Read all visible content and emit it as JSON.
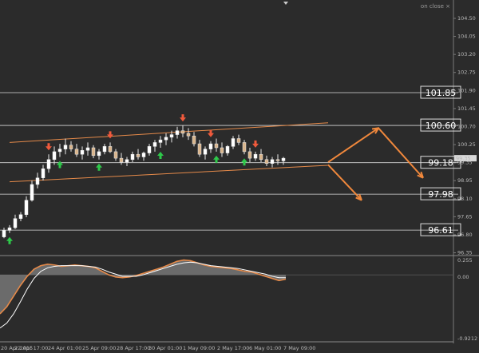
{
  "window": {
    "status_text": "on close ×"
  },
  "chart_data": [
    {
      "type": "candlestick",
      "ylim": [
        95.7,
        105.2
      ],
      "y_ticks": [
        "104.50",
        "104.05",
        "103.20",
        "102.75",
        "101.90",
        "101.45",
        "100.70",
        "100.25",
        "99.35",
        "98.95",
        "98.10",
        "97.65",
        "96.80",
        "96.35"
      ],
      "x_tick_labels": [
        "20 Apr 2015",
        "22 Apr 17:00",
        "24 Apr 01:00",
        "25 Apr 09:00",
        "28 Apr 17:00",
        "30 Apr 01:00",
        "1 May 09:00",
        "2 May 17:00",
        "6 May 01:00",
        "7 May 09:00"
      ],
      "current_price": "99.35",
      "horizontal_levels": [
        {
          "value": 101.85,
          "label": "101.85"
        },
        {
          "value": 100.6,
          "label": "100.60"
        },
        {
          "value": 99.18,
          "label": "99.18"
        },
        {
          "value": 97.98,
          "label": "97.98"
        },
        {
          "value": 96.61,
          "label": "96.61"
        }
      ],
      "channel": {
        "upper": [
          [
            1,
            99.95
          ],
          [
            58,
            100.7
          ]
        ],
        "lower": [
          [
            1,
            98.45
          ],
          [
            58,
            99.08
          ]
        ]
      },
      "forecast_arrows": [
        {
          "points": [
            [
              58,
              99.2
            ],
            [
              67,
              100.5
            ],
            [
              75,
              98.6
            ]
          ]
        },
        {
          "points": [
            [
              58,
              99.1
            ],
            [
              64,
              97.75
            ]
          ]
        }
      ],
      "candles": [
        [
          96.35,
          96.7,
          96.3,
          96.6
        ],
        [
          96.6,
          96.8,
          96.5,
          96.7
        ],
        [
          96.7,
          97.2,
          96.65,
          97.05
        ],
        [
          97.05,
          97.3,
          96.95,
          97.2
        ],
        [
          97.2,
          97.9,
          97.1,
          97.75
        ],
        [
          97.75,
          98.5,
          97.7,
          98.35
        ],
        [
          98.35,
          98.8,
          98.2,
          98.6
        ],
        [
          98.6,
          99.1,
          98.5,
          98.95
        ],
        [
          98.95,
          99.5,
          98.8,
          99.3
        ],
        [
          99.3,
          99.8,
          99.1,
          99.6
        ],
        [
          99.6,
          99.9,
          99.4,
          99.7
        ],
        [
          99.7,
          100.1,
          99.5,
          99.85
        ],
        [
          99.85,
          100.0,
          99.6,
          99.7
        ],
        [
          99.7,
          99.9,
          99.4,
          99.5
        ],
        [
          99.5,
          99.8,
          99.3,
          99.65
        ],
        [
          99.65,
          99.95,
          99.45,
          99.75
        ],
        [
          99.75,
          99.85,
          99.35,
          99.45
        ],
        [
          99.45,
          99.7,
          99.3,
          99.6
        ],
        [
          99.6,
          99.9,
          99.5,
          99.8
        ],
        [
          99.8,
          99.95,
          99.55,
          99.6
        ],
        [
          99.6,
          99.7,
          99.25,
          99.35
        ],
        [
          99.35,
          99.55,
          99.1,
          99.2
        ],
        [
          99.2,
          99.4,
          99.05,
          99.3
        ],
        [
          99.3,
          99.6,
          99.2,
          99.5
        ],
        [
          99.5,
          99.7,
          99.3,
          99.4
        ],
        [
          99.4,
          99.6,
          99.25,
          99.55
        ],
        [
          99.55,
          99.9,
          99.45,
          99.8
        ],
        [
          99.8,
          100.05,
          99.6,
          99.95
        ],
        [
          99.95,
          100.2,
          99.75,
          100.05
        ],
        [
          100.05,
          100.3,
          99.85,
          100.15
        ],
        [
          100.15,
          100.4,
          99.95,
          100.25
        ],
        [
          100.25,
          100.55,
          100.1,
          100.4
        ],
        [
          100.4,
          100.6,
          100.15,
          100.3
        ],
        [
          100.3,
          100.5,
          100.05,
          100.2
        ],
        [
          100.2,
          100.35,
          99.8,
          99.9
        ],
        [
          99.9,
          100.05,
          99.4,
          99.5
        ],
        [
          99.5,
          99.8,
          99.3,
          99.7
        ],
        [
          99.7,
          100.0,
          99.55,
          99.9
        ],
        [
          99.9,
          100.1,
          99.6,
          99.75
        ],
        [
          99.75,
          99.95,
          99.4,
          99.55
        ],
        [
          99.55,
          99.85,
          99.45,
          99.8
        ],
        [
          99.8,
          100.2,
          99.7,
          100.1
        ],
        [
          100.1,
          100.25,
          99.85,
          99.95
        ],
        [
          99.95,
          100.05,
          99.5,
          99.6
        ],
        [
          99.6,
          99.75,
          99.2,
          99.35
        ],
        [
          99.35,
          99.6,
          99.25,
          99.5
        ],
        [
          99.5,
          99.7,
          99.2,
          99.3
        ],
        [
          99.3,
          99.45,
          99.05,
          99.15
        ],
        [
          99.15,
          99.4,
          99.0,
          99.3
        ],
        [
          99.3,
          99.5,
          99.1,
          99.25
        ],
        [
          99.25,
          99.4,
          99.1,
          99.35
        ]
      ],
      "buy_signals": [
        1,
        10,
        17,
        28,
        38,
        43
      ],
      "sell_signals": [
        8,
        19,
        32,
        37,
        45
      ]
    },
    {
      "type": "line",
      "ylim": [
        -0.9,
        0.25
      ],
      "y_ticks": [
        "0.255",
        "0.00",
        "-0.9212"
      ],
      "series": [
        {
          "values": [
            -0.55,
            -0.45,
            -0.3,
            -0.15,
            -0.02,
            0.08,
            0.13,
            0.15,
            0.14,
            0.12,
            0.13,
            0.14,
            0.13,
            0.12,
            0.1,
            0.05,
            0.0,
            -0.03,
            -0.04,
            -0.03,
            -0.01,
            0.02,
            0.05,
            0.08,
            0.11,
            0.15,
            0.19,
            0.21,
            0.2,
            0.17,
            0.14,
            0.12,
            0.11,
            0.1,
            0.09,
            0.07,
            0.05,
            0.04,
            0.01,
            -0.02,
            -0.05,
            -0.08,
            -0.06
          ]
        },
        {
          "values": [
            -0.75,
            -0.68,
            -0.55,
            -0.38,
            -0.2,
            -0.05,
            0.05,
            0.1,
            0.12,
            0.13,
            0.13,
            0.13,
            0.13,
            0.12,
            0.11,
            0.08,
            0.04,
            0.01,
            -0.02,
            -0.02,
            -0.02,
            0.0,
            0.03,
            0.06,
            0.09,
            0.12,
            0.15,
            0.17,
            0.18,
            0.17,
            0.15,
            0.13,
            0.12,
            0.11,
            0.1,
            0.09,
            0.07,
            0.05,
            0.03,
            0.01,
            -0.02,
            -0.04,
            -0.04
          ]
        }
      ]
    }
  ]
}
